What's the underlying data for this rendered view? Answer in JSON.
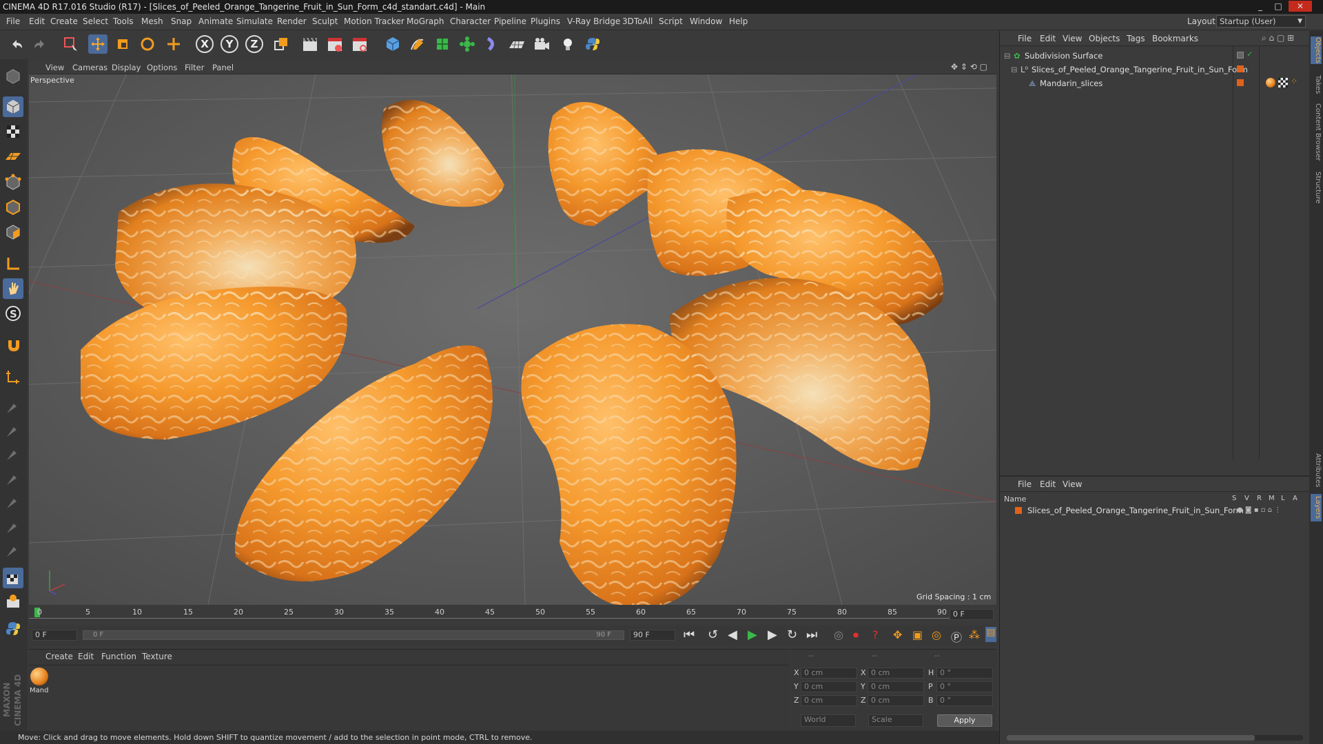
{
  "window": {
    "title": "CINEMA 4D R17.016 Studio (R17) - [Slices_of_Peeled_Orange_Tangerine_Fruit_in_Sun_Form_c4d_standart.c4d] - Main",
    "minimize": "_",
    "maximize": "□",
    "close": "✕"
  },
  "menubar": {
    "items": [
      "File",
      "Edit",
      "Create",
      "Select",
      "Tools",
      "Mesh",
      "Snap",
      "Animate",
      "Simulate",
      "Render",
      "Sculpt",
      "Motion Tracker",
      "MoGraph",
      "Character",
      "Pipeline",
      "Plugins",
      "V-Ray Bridge",
      "3DToAll",
      "Script",
      "Window",
      "Help"
    ],
    "layout_label": "Layout:",
    "layout_value": "Startup (User)"
  },
  "toolbar": {
    "axis_x": "X",
    "axis_y": "Y",
    "axis_z": "Z"
  },
  "viewport": {
    "menu": [
      "View",
      "Cameras",
      "Display",
      "Options",
      "Filter",
      "Panel"
    ],
    "camera_label": "Perspective",
    "grid_spacing": "Grid Spacing : 1 cm"
  },
  "timeline": {
    "ticks": [
      "0",
      "5",
      "10",
      "15",
      "20",
      "25",
      "30",
      "35",
      "40",
      "45",
      "50",
      "55",
      "60",
      "65",
      "70",
      "75",
      "80",
      "85",
      "90"
    ],
    "current_frame": "0 F",
    "start_field": "0 F",
    "range_start": "0 F",
    "range_end": "90 F",
    "end_field": "90 F"
  },
  "material_manager": {
    "menu": [
      "Create",
      "Edit",
      "Function",
      "Texture"
    ],
    "material_label": "Mand"
  },
  "coordinates": {
    "headers": [
      "--",
      "--",
      "--"
    ],
    "rows": [
      {
        "pos_axis": "X",
        "pos": "0 cm",
        "size_axis": "X",
        "size": "0 cm",
        "rot_axis": "H",
        "rot": "0 °"
      },
      {
        "pos_axis": "Y",
        "pos": "0 cm",
        "size_axis": "Y",
        "size": "0 cm",
        "rot_axis": "P",
        "rot": "0 °"
      },
      {
        "pos_axis": "Z",
        "pos": "0 cm",
        "size_axis": "Z",
        "size": "0 cm",
        "rot_axis": "B",
        "rot": "0 °"
      }
    ],
    "mode": "World",
    "transform": "Scale",
    "apply": "Apply"
  },
  "status": "Move: Click and drag to move elements. Hold down SHIFT to quantize movement / add to the selection in point mode, CTRL to remove.",
  "object_manager": {
    "menu": [
      "File",
      "Edit",
      "View",
      "Objects",
      "Tags",
      "Bookmarks"
    ],
    "objects": [
      {
        "name": "Subdivision Surface"
      },
      {
        "name": "Slices_of_Peeled_Orange_Tangerine_Fruit_in_Sun_Form"
      },
      {
        "name": "Mandarin_slices"
      }
    ]
  },
  "layer_manager": {
    "menu": [
      "File",
      "Edit",
      "View"
    ],
    "name_header": "Name",
    "cols": [
      "S",
      "V",
      "R",
      "M",
      "L",
      "A"
    ],
    "layer": "Slices_of_Peeled_Orange_Tangerine_Fruit_in_Sun_Form"
  },
  "side_tabs": [
    "Objects",
    "Takes",
    "Content Browser",
    "Structure",
    "Attributes",
    "Layers"
  ],
  "branding": "MAXON CINEMA 4D",
  "colors": {
    "accent": "#f08a1c",
    "selected_blue": "#4a6a9a",
    "layer_orange": "#e0621a"
  }
}
